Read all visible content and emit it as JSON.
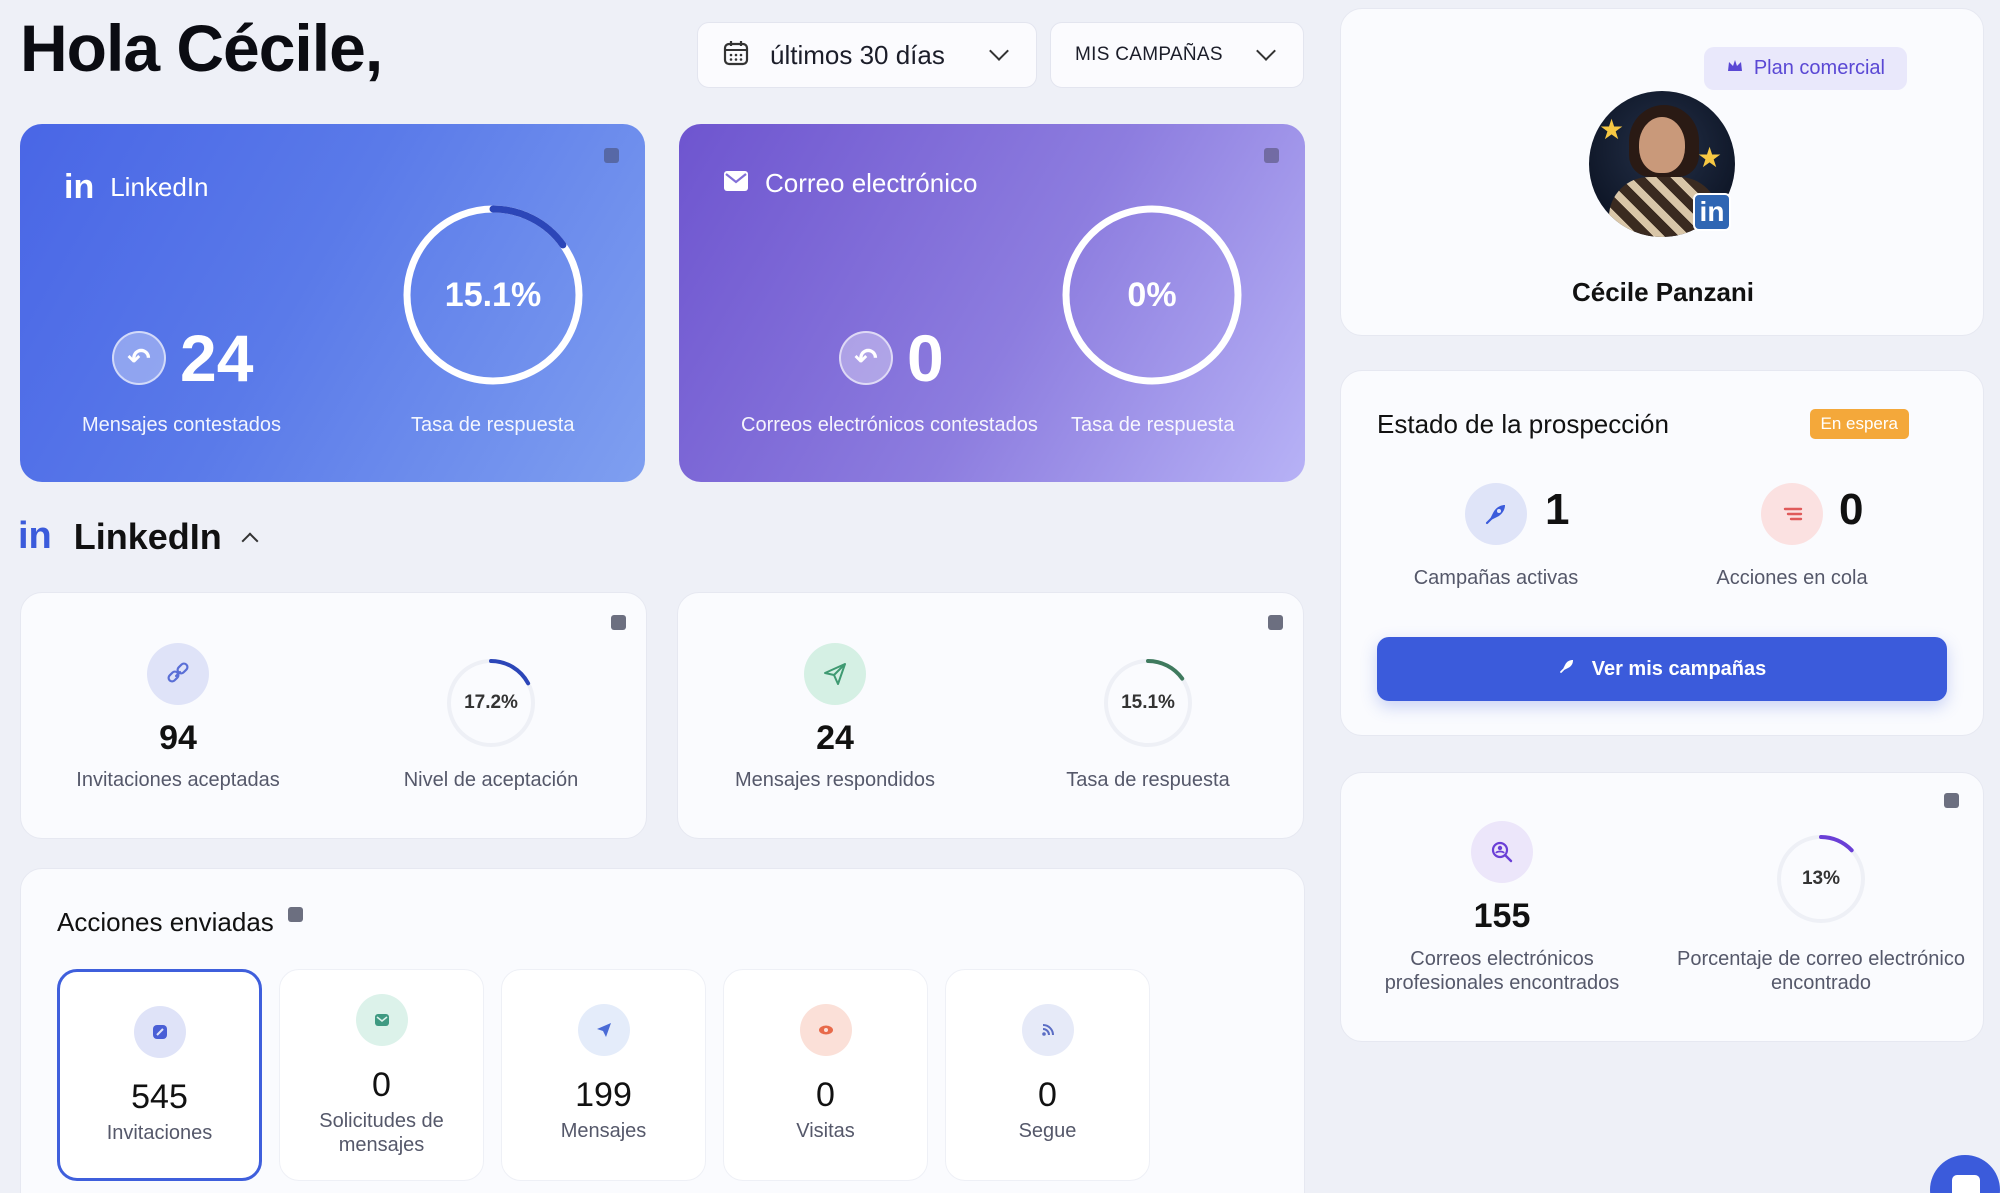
{
  "greeting": "Hola Cécile,",
  "filters": {
    "date_range": "últimos 30 días",
    "campaigns": "MIS CAMPAÑAS"
  },
  "hero": {
    "linkedin": {
      "title": "LinkedIn",
      "count": "24",
      "count_caption": "Mensajes contestados",
      "rate": "15.1%",
      "rate_fraction": 0.151,
      "rate_caption": "Tasa de respuesta"
    },
    "email": {
      "title": "Correo electrónico",
      "count": "0",
      "count_caption": "Correos electrónicos contestados",
      "rate": "0%",
      "rate_fraction": 0,
      "rate_caption": "Tasa de respuesta"
    }
  },
  "section": {
    "badge": "in",
    "title": "LinkedIn"
  },
  "stats": {
    "invitations": {
      "value": "94",
      "caption": "Invitaciones aceptadas",
      "rate": "17.2%",
      "rate_fraction": 0.172,
      "rate_caption": "Nivel de aceptación"
    },
    "messages": {
      "value": "24",
      "caption": "Mensajes respondidos",
      "rate": "15.1%",
      "rate_fraction": 0.151,
      "rate_caption": "Tasa de respuesta"
    }
  },
  "actions": {
    "title": "Acciones enviadas",
    "tiles": [
      {
        "value": "545",
        "label": "Invitaciones"
      },
      {
        "value": "0",
        "label": "Solicitudes de mensajes"
      },
      {
        "value": "199",
        "label": "Mensajes"
      },
      {
        "value": "0",
        "label": "Visitas"
      },
      {
        "value": "0",
        "label": "Segue"
      }
    ]
  },
  "profile": {
    "plan": "Plan comercial",
    "name": "Cécile Panzani",
    "badge": "in"
  },
  "prospecting": {
    "title": "Estado de la prospección",
    "status": "En espera",
    "active_campaigns": "1",
    "active_campaigns_caption": "Campañas activas",
    "queued_actions": "0",
    "queued_actions_caption": "Acciones en cola",
    "cta": "Ver mis campañas"
  },
  "emails_found": {
    "value": "155",
    "caption": "Correos electrónicos profesionales encontrados",
    "rate": "13%",
    "rate_fraction": 0.13,
    "rate_caption": "Porcentaje de correo electrónico encontrado"
  },
  "colors": {
    "primary": "#3b5bdb",
    "linkedin_ring": "#2c46b8",
    "green_ring": "#3f7a5e",
    "purple_ring": "#6a3fd6",
    "waiting": "#f4a83a"
  }
}
